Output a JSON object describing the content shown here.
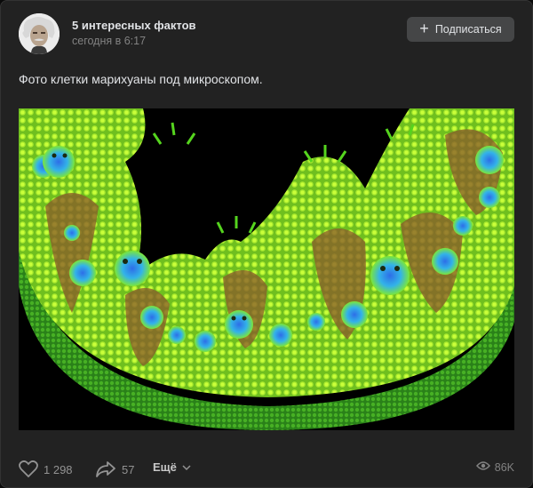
{
  "post": {
    "author": "5 интересных фактов",
    "time": "сегодня в 6:17",
    "subscribe_label": "Подписаться",
    "text": "Фото клетки марихуаны под микроскопом."
  },
  "footer": {
    "likes": "1 298",
    "shares": "57",
    "more_label": "Ещё",
    "views": "86K"
  },
  "colors": {
    "card_bg": "#222222",
    "button_bg": "#454647",
    "muted_text": "#828282"
  },
  "icons": [
    "plus-icon",
    "heart-icon",
    "share-icon",
    "chevron-down-icon",
    "eye-icon"
  ]
}
